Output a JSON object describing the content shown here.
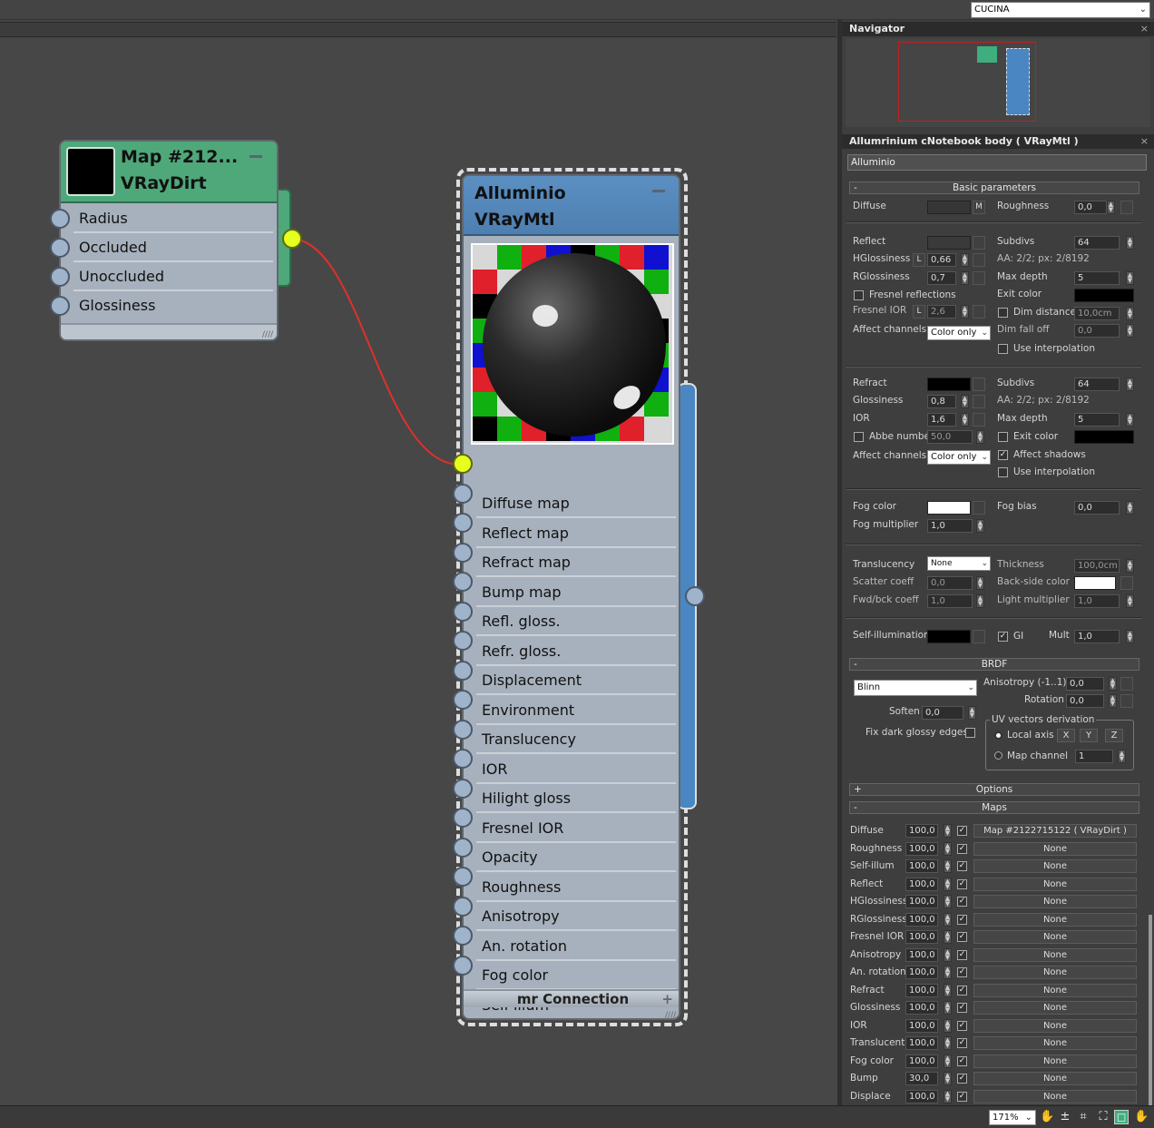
{
  "topbar": {
    "scene_select": "CUCINA"
  },
  "navigator": {
    "title": "Navigator",
    "close": "×"
  },
  "material_panel": {
    "title": "Allumrinium cNotebook body  ( VRayMtl )",
    "close": "×",
    "name_field": "Alluminio",
    "basic": {
      "header": "Basic parameters",
      "diffuse": "Diffuse",
      "m_button": "M",
      "roughness": "Roughness",
      "roughness_val": "0,0",
      "reflect": "Reflect",
      "subdivs": "Subdivs",
      "subdivs_val": "64",
      "hglossiness": "HGlossiness",
      "l_btn": "L",
      "hgloss_val": "0,66",
      "aa": "AA: 2/2; px: 2/8192",
      "rglossiness": "RGlossiness",
      "rgloss_val": "0,7",
      "max_depth": "Max depth",
      "max_depth_val": "5",
      "fresnel": "Fresnel reflections",
      "exit_color": "Exit color",
      "fresnel_ior": "Fresnel IOR",
      "fresnel_ior_val": "2,6",
      "dim_distance": "Dim distance",
      "dim_distance_val": "10,0cm",
      "affect_channels": "Affect channels",
      "affect_channels_val": "Color only",
      "dim_fall_off": "Dim fall off",
      "dim_fall_off_val": "0,0",
      "use_interpolation": "Use interpolation",
      "refract": "Refract",
      "r_subdivs_val": "64",
      "glossiness": "Glossiness",
      "gloss_val": "0,8",
      "r_aa": "AA: 2/2; px: 2/8192",
      "ior": "IOR",
      "ior_val": "1,6",
      "r_max_depth_val": "5",
      "abbe": "Abbe number",
      "abbe_val": "50,0",
      "r_exit_color": "Exit color",
      "r_affect_channels_val": "Color only",
      "affect_shadows": "Affect shadows",
      "r_use_interpolation": "Use interpolation",
      "fog_color": "Fog color",
      "fog_bias": "Fog bias",
      "fog_bias_val": "0,0",
      "fog_multiplier": "Fog multiplier",
      "fog_mult_val": "1,0",
      "translucency": "Translucency",
      "translucency_val": "None",
      "thickness": "Thickness",
      "thickness_val": "100,0cm",
      "scatter_coeff": "Scatter coeff",
      "scatter_val": "0,0",
      "back_side_color": "Back-side color",
      "fwd_bck": "Fwd/bck coeff",
      "fwd_bck_val": "1,0",
      "light_multiplier": "Light multiplier",
      "light_mult_val": "1,0",
      "self_illum": "Self-illumination",
      "gi": "GI",
      "mult": "Mult",
      "mult_val": "1,0"
    },
    "brdf": {
      "header": "BRDF",
      "type": "Blinn",
      "anisotropy": "Anisotropy (-1..1)",
      "anisotropy_val": "0,0",
      "rotation": "Rotation",
      "rotation_val": "0,0",
      "soften": "Soften",
      "soften_val": "0,0",
      "uv_title": "UV vectors derivation",
      "fix_dark": "Fix dark glossy edges",
      "local_axis": "Local axis",
      "x": "X",
      "y": "Y",
      "z": "Z",
      "map_channel": "Map channel",
      "map_channel_val": "1"
    },
    "options": {
      "header": "Options",
      "sign": "+"
    },
    "maps": {
      "header": "Maps",
      "sign": "-",
      "rows": [
        {
          "label": "Diffuse",
          "amount": "100,0",
          "map": "Map #2122715122  ( VRayDirt )"
        },
        {
          "label": "Roughness",
          "amount": "100,0",
          "map": "None"
        },
        {
          "label": "Self-illum",
          "amount": "100,0",
          "map": "None"
        },
        {
          "label": "Reflect",
          "amount": "100,0",
          "map": "None"
        },
        {
          "label": "HGlossiness",
          "amount": "100,0",
          "map": "None"
        },
        {
          "label": "RGlossiness",
          "amount": "100,0",
          "map": "None"
        },
        {
          "label": "Fresnel IOR",
          "amount": "100,0",
          "map": "None"
        },
        {
          "label": "Anisotropy",
          "amount": "100,0",
          "map": "None"
        },
        {
          "label": "An. rotation",
          "amount": "100,0",
          "map": "None"
        },
        {
          "label": "Refract",
          "amount": "100,0",
          "map": "None"
        },
        {
          "label": "Glossiness",
          "amount": "100,0",
          "map": "None"
        },
        {
          "label": "IOR",
          "amount": "100,0",
          "map": "None"
        },
        {
          "label": "Translucent",
          "amount": "100,0",
          "map": "None"
        },
        {
          "label": "Fog color",
          "amount": "100,0",
          "map": "None"
        },
        {
          "label": "Bump",
          "amount": "30,0",
          "map": "None"
        },
        {
          "label": "Displace",
          "amount": "100,0",
          "map": "None"
        }
      ]
    }
  },
  "vraydirt_node": {
    "name": "Map #212...",
    "type": "VRayDirt",
    "slots": [
      "Radius",
      "Occluded",
      "Unoccluded",
      "Glossiness"
    ]
  },
  "vraymtl_node": {
    "name": "Alluminio",
    "type": "VRayMtl",
    "slots": [
      "Diffuse map",
      "Reflect map",
      "Refract map",
      "Bump map",
      "Refl. gloss.",
      "Refr. gloss.",
      "Displacement",
      "Environment",
      "Translucency",
      "IOR",
      "Hilight gloss",
      "Fresnel IOR",
      "Opacity",
      "Roughness",
      "Anisotropy",
      "An. rotation",
      "Fog color",
      "Self-illum"
    ],
    "footer": "mr Connection"
  },
  "statusbar": {
    "zoom": "171%"
  },
  "colors": {
    "dirt_node_header": "#4fa87a",
    "mtl_node_header": "#5b8fc2",
    "wire": "#e0302a",
    "active_socket": "#e6ff1e"
  }
}
